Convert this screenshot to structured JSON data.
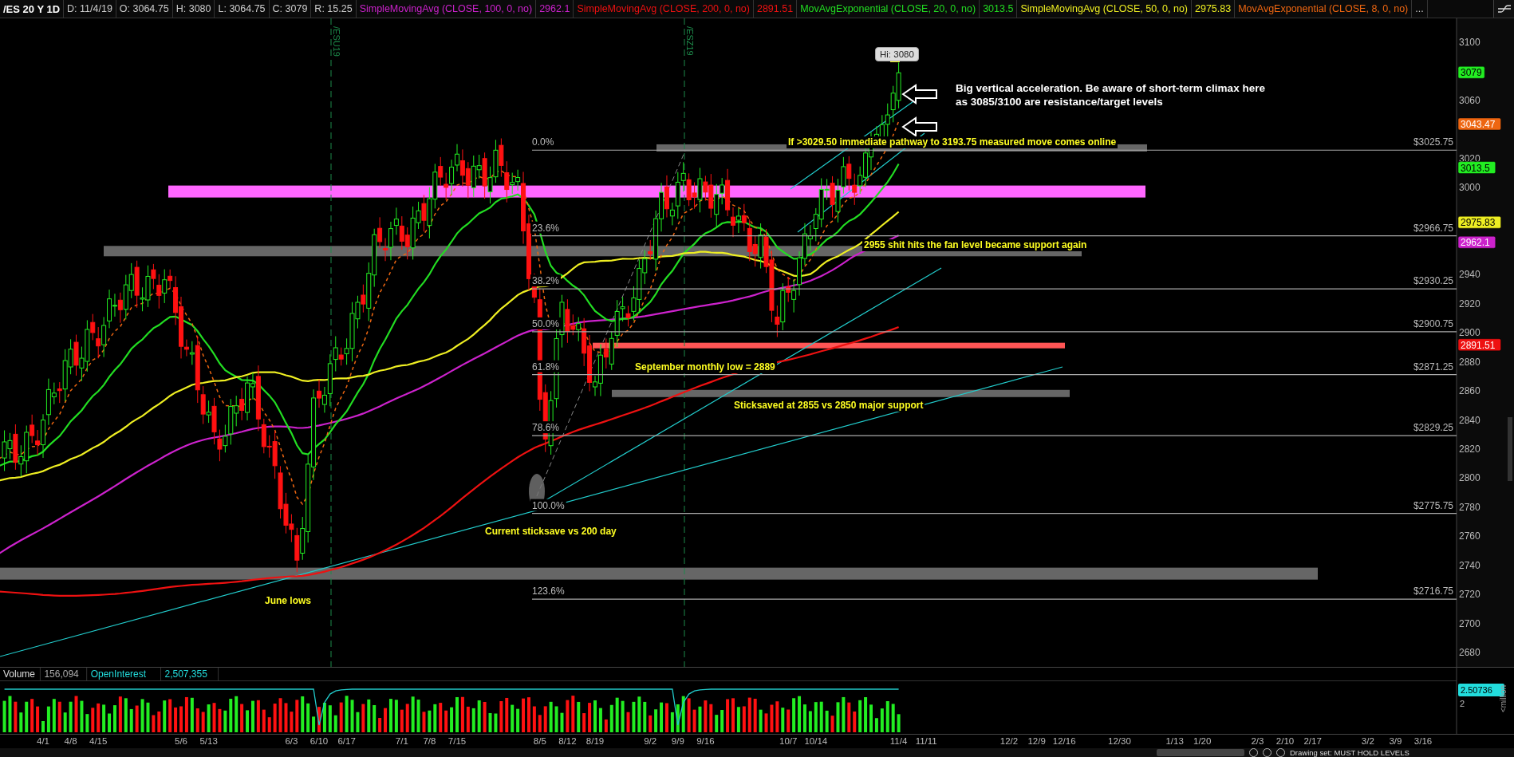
{
  "header": {
    "symbol": "/ES 20 Y 1D",
    "fields": [
      "D: 11/4/19",
      "O: 3064.75",
      "H: 3080",
      "L: 3064.75",
      "C: 3079",
      "R: 15.25"
    ],
    "studies": [
      {
        "kind": "sma",
        "name": "SimpleMovingAvg (CLOSE, 100, 0, no)",
        "value": "2962.1",
        "color": "#cc22cc"
      },
      {
        "kind": "sma",
        "name": "SimpleMovingAvg (CLOSE, 200, 0, no)",
        "value": "2891.51",
        "color": "#ee1111"
      },
      {
        "kind": "ema",
        "name": "MovAvgExponential (CLOSE, 20, 0, no)",
        "value": "3013.5",
        "color": "#22dd22"
      },
      {
        "kind": "sma",
        "name": "SimpleMovingAvg (CLOSE, 50, 0, no)",
        "value": "2975.83",
        "color": "#eeee22"
      },
      {
        "kind": "ema",
        "name": "MovAvgExponential (CLOSE, 8, 0, no)",
        "color": "#ee6611"
      }
    ],
    "more": "..."
  },
  "chart": {
    "contracts": [
      "/ESU19",
      "/ESZ19"
    ],
    "hi_label": "Hi: 3080",
    "fib_levels": [
      {
        "pct": "0.0%",
        "price": "$3025.75"
      },
      {
        "pct": "23.6%",
        "price": "$2966.75"
      },
      {
        "pct": "38.2%",
        "price": "$2930.25"
      },
      {
        "pct": "50.0%",
        "price": "$2900.75"
      },
      {
        "pct": "61.8%",
        "price": "$2871.25"
      },
      {
        "pct": "78.6%",
        "price": "$2829.25"
      },
      {
        "pct": "100.0%",
        "price": "$2775.75"
      },
      {
        "pct": "123.6%",
        "price": "$2716.75"
      }
    ],
    "annotations": [
      {
        "kind": "callout",
        "text": "Big vertical acceleration. Be aware of short-term climax here\nas 3085/3100 are resistance/target levels"
      },
      {
        "kind": "label",
        "text": "If >3029.50 immediate pathway to 3193.75 measured move comes online"
      },
      {
        "kind": "label",
        "text": "2955 shit hits the fan level became support again"
      },
      {
        "kind": "label",
        "text": "September monthly low = 2889"
      },
      {
        "kind": "label",
        "text": "Sticksaved at 2855 vs 2850 major support"
      },
      {
        "kind": "label",
        "text": "Current sticksave vs 200 day"
      },
      {
        "kind": "label",
        "text": "June lows"
      }
    ],
    "price_ticks": [
      "3100",
      "3060",
      "3020",
      "3000",
      "2940",
      "2920",
      "2900",
      "2880",
      "2860",
      "2840",
      "2820",
      "2800",
      "2780",
      "2760",
      "2740",
      "2720",
      "2700",
      "2680"
    ],
    "price_tags": [
      {
        "text": "3079",
        "color": "#22ee22"
      },
      {
        "text": "3043.47",
        "color": "#ee6611"
      },
      {
        "text": "3013.5",
        "color": "#22ee22"
      },
      {
        "text": "2975.83",
        "color": "#eeee22"
      },
      {
        "text": "2962.1",
        "color": "#cc22cc"
      },
      {
        "text": "2891.51",
        "color": "#ee1111"
      }
    ]
  },
  "volume": {
    "label": "Volume",
    "value": "156,094",
    "oi_label": "OpenInterest",
    "oi_value": "2,507,355",
    "tag": "2.50736",
    "tick": "2",
    "unit": "<million"
  },
  "x_axis": [
    "4/1",
    "4/8",
    "4/15",
    "5/6",
    "5/13",
    "6/3",
    "6/10",
    "6/17",
    "7/1",
    "7/8",
    "7/15",
    "8/5",
    "8/12",
    "8/19",
    "9/2",
    "9/9",
    "9/16",
    "10/7",
    "10/14",
    "11/4",
    "11/11",
    "12/2",
    "12/9",
    "12/16",
    "12/30",
    "1/13",
    "1/20",
    "2/3",
    "2/10",
    "2/17",
    "3/2",
    "3/9",
    "3/16"
  ],
  "status": {
    "drawing_set": "Drawing set: MUST HOLD LEVELS"
  }
}
